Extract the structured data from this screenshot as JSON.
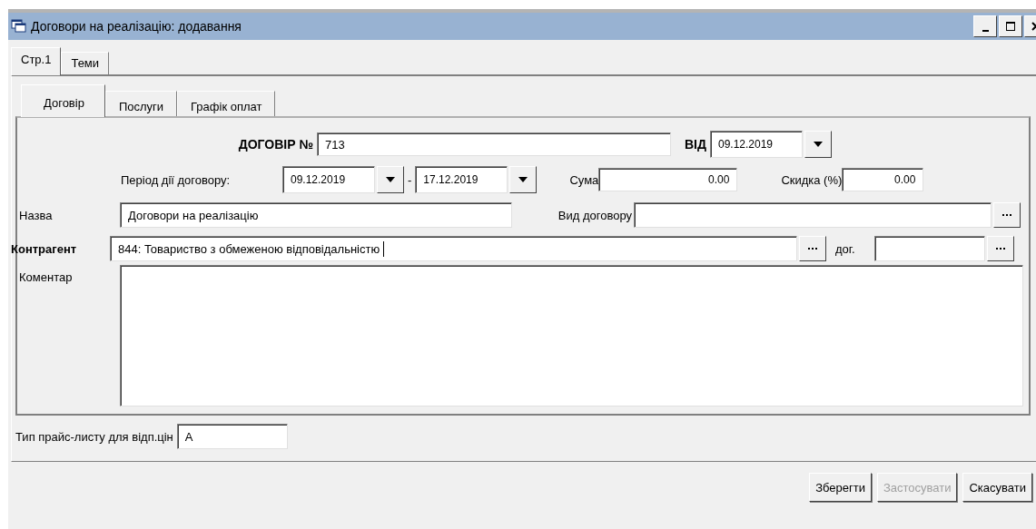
{
  "window": {
    "title": "Договори на реалізацію: додавання"
  },
  "tabs": [
    {
      "label": "Стр.1",
      "selected": true
    },
    {
      "label": "Теми",
      "selected": false
    }
  ],
  "inner_tabs": [
    {
      "label": "Договір",
      "selected": true
    },
    {
      "label": "Послуги",
      "selected": false
    },
    {
      "label": "Графік оплат",
      "selected": false
    }
  ],
  "contract_number": {
    "label": "ДОГОВІР №",
    "value": "713"
  },
  "contract_date": {
    "label": "ВІД",
    "value": "09.12.2019"
  },
  "period": {
    "label": "Період дії договору:",
    "from": "09.12.2019",
    "separator": "-",
    "to": "17.12.2019"
  },
  "sum": {
    "label": "Сума",
    "value": "0.00"
  },
  "discount": {
    "label": "Скидка (%)",
    "value": "0.00"
  },
  "name": {
    "label": "Назва",
    "value": "Договори на реалізацію"
  },
  "contract_type": {
    "label": "Вид договору"
  },
  "counterparty": {
    "label": "Контрагент",
    "value": "844: Товариство з обмеженою відповідальністю",
    "focused": true
  },
  "counterparty_contract": {
    "label": "дог."
  },
  "comment": {
    "label": "Коментар"
  },
  "price_list_type": {
    "label": "Тип прайс-листу для відп.цін",
    "value": "А"
  },
  "buttons": [
    {
      "label": "Зберегти",
      "disabled": false
    },
    {
      "label": "Застосувати",
      "disabled": true
    },
    {
      "label": "Скасувати",
      "disabled": false
    }
  ]
}
